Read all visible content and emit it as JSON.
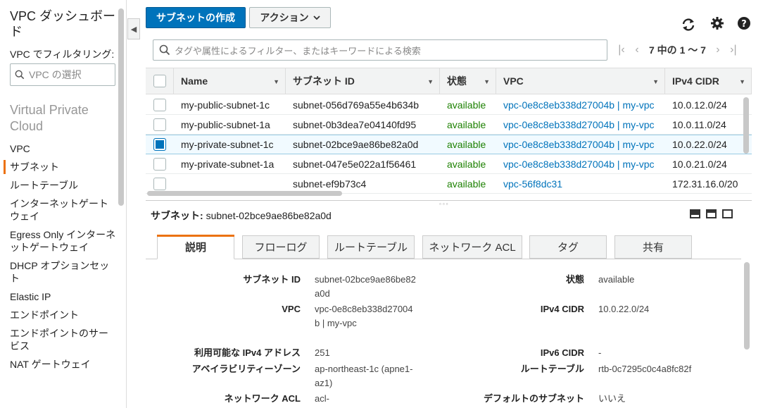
{
  "sidebar": {
    "title": "VPC ダッシュボード",
    "filter_label": "VPC でフィルタリング:",
    "vpc_select_placeholder": "VPC の選択",
    "section": "Virtual Private Cloud",
    "items": [
      {
        "label": "VPC",
        "active": false
      },
      {
        "label": "サブネット",
        "active": true
      },
      {
        "label": "ルートテーブル",
        "active": false
      },
      {
        "label": "インターネットゲートウェイ",
        "active": false
      },
      {
        "label": "Egress Only インターネットゲートウェイ",
        "active": false
      },
      {
        "label": "DHCP オプションセット",
        "active": false
      },
      {
        "label": "Elastic IP",
        "active": false
      },
      {
        "label": "エンドポイント",
        "active": false
      },
      {
        "label": "エンドポイントのサービス",
        "active": false
      },
      {
        "label": "NAT ゲートウェイ",
        "active": false
      }
    ]
  },
  "toolbar": {
    "create_label": "サブネットの作成",
    "actions_label": "アクション",
    "refresh_icon": "refresh-icon",
    "settings_icon": "gear-icon",
    "help_icon": "help-icon"
  },
  "search": {
    "placeholder": "タグや属性によるフィルター、またはキーワードによる検索"
  },
  "pagination": {
    "range": "7 中の 1 ～ 7"
  },
  "table": {
    "columns": [
      "Name",
      "サブネット ID",
      "状態",
      "VPC",
      "IPv4 CIDR"
    ],
    "rows": [
      {
        "name": "my-public-subnet-1c",
        "subnet_id": "subnet-056d769a55e4b634b",
        "state": "available",
        "vpc": "vpc-0e8c8eb338d27004b | my-vpc",
        "cidr": "10.0.12.0/24",
        "selected": false
      },
      {
        "name": "my-public-subnet-1a",
        "subnet_id": "subnet-0b3dea7e04140fd95",
        "state": "available",
        "vpc": "vpc-0e8c8eb338d27004b | my-vpc",
        "cidr": "10.0.11.0/24",
        "selected": false
      },
      {
        "name": "my-private-subnet-1c",
        "subnet_id": "subnet-02bce9ae86be82a0d",
        "state": "available",
        "vpc": "vpc-0e8c8eb338d27004b | my-vpc",
        "cidr": "10.0.22.0/24",
        "selected": true
      },
      {
        "name": "my-private-subnet-1a",
        "subnet_id": "subnet-047e5e022a1f56461",
        "state": "available",
        "vpc": "vpc-0e8c8eb338d27004b | my-vpc",
        "cidr": "10.0.21.0/24",
        "selected": false
      },
      {
        "name": "",
        "subnet_id": "subnet-ef9b73c4",
        "state": "available",
        "vpc": "vpc-56f8dc31",
        "cidr": "172.31.16.0/20",
        "selected": false
      }
    ]
  },
  "detail": {
    "heading_label": "サブネット:",
    "heading_value": "subnet-02bce9ae86be82a0d",
    "tabs": [
      "説明",
      "フローログ",
      "ルートテーブル",
      "ネットワーク ACL",
      "タグ",
      "共有"
    ],
    "left": [
      {
        "key": "サブネット ID",
        "value": "subnet-02bce9ae86be82a0d",
        "link": false
      },
      {
        "key": "VPC",
        "value": "vpc-0e8c8eb338d27004b | my-vpc",
        "link": true
      },
      {
        "key": "利用可能な IPv4 アドレス",
        "value": "251",
        "link": false
      },
      {
        "key": "アベイラビリティーゾーン",
        "value": "ap-northeast-1c (apne1-az1)",
        "link": false
      },
      {
        "key": "ネットワーク ACL",
        "value": "acl-",
        "link": true
      }
    ],
    "right": [
      {
        "key": "状態",
        "value": "available",
        "green": true
      },
      {
        "key": "IPv4 CIDR",
        "value": "10.0.22.0/24"
      },
      {
        "key": "IPv6 CIDR",
        "value": "-"
      },
      {
        "key": "ルートテーブル",
        "value": "rtb-0c7295c0c4a8fc82f",
        "link": true
      },
      {
        "key": "デフォルトのサブネット",
        "value": "いいえ"
      }
    ]
  },
  "colors": {
    "primary": "#0073bb",
    "accent": "#ec7211",
    "status_green": "#1d8102"
  }
}
